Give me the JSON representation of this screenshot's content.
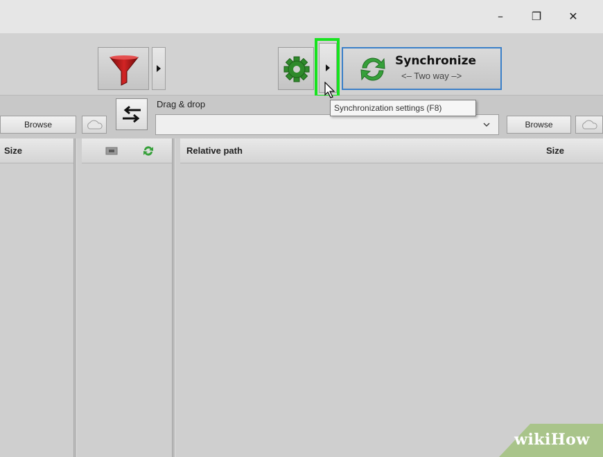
{
  "window": {
    "minimize_glyph": "–",
    "restore_glyph": "❐",
    "close_glyph": "✕"
  },
  "toolbar": {
    "filter_icon": "funnel-icon",
    "settings_icon": "gear-icon",
    "sync_button": {
      "title": "Synchronize",
      "subtitle": "<– Two way –>"
    },
    "tooltip": "Synchronization settings (F8)"
  },
  "paths": {
    "left_browse": "Browse",
    "right_browse": "Browse",
    "drag_label": "Drag & drop",
    "path_value": ""
  },
  "grid": {
    "left_size_header": "Size",
    "relative_path_header": "Relative path",
    "right_size_header": "Size"
  },
  "watermark": {
    "text": "wikiHow"
  },
  "colors": {
    "highlight": "#17e31f",
    "sync_border": "#3a7fc8",
    "filter_red": "#b01818",
    "gear_green": "#2f8a2b",
    "watermark_bg": "#a9c48a"
  }
}
